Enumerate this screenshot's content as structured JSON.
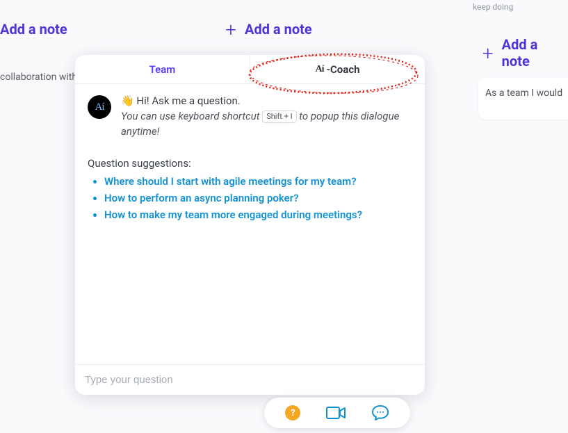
{
  "background": {
    "left_add_note": "Add a note",
    "center_add_note": "Add a note",
    "right_add_note": "Add a note",
    "collab_snippet": "collaboration with",
    "keep_doing": "keep doing",
    "team_card_text": "As a team I would"
  },
  "panel": {
    "tabs": {
      "team": "Team",
      "coach_prefix": "Aí",
      "coach_suffix": "-Coach"
    },
    "avatar_label": "Aí",
    "greeting": "Hi! Ask me a question.",
    "greeting_emoji": "👋",
    "hint_before": "You can use keyboard shortcut",
    "shortcut": "Shift + I",
    "hint_after": "to popup this dialogue anytime!",
    "suggestions_label": "Question suggestions:",
    "suggestions": [
      "Where should I start with agile meetings for my team?",
      "How to perform an async planning poker?",
      "How to make my team more engaged during meetings?"
    ],
    "input_placeholder": "Type your question"
  },
  "dock": {
    "help_label": "?"
  }
}
